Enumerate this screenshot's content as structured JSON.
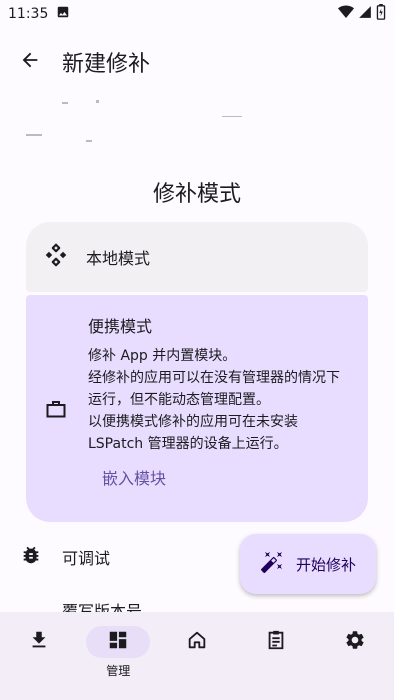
{
  "status_bar": {
    "time": "11:35",
    "icons": [
      "image-icon",
      "wifi-icon",
      "signal-icon",
      "battery-icon"
    ]
  },
  "app_bar": {
    "title": "新建修补",
    "back_icon": "arrow-back-icon"
  },
  "patch_mode": {
    "section_title": "修补模式",
    "options": [
      {
        "label": "本地模式",
        "icon": "apps-diamond-icon",
        "selected": false
      },
      {
        "label": "便携模式",
        "icon": "work-briefcase-icon",
        "selected": true,
        "description": [
          "修补 App 并内置模块。",
          "经修补的应用可以在没有管理器的情况下运行，但不能动态管理配置。",
          "以便携模式修补的应用可在未安装 LSPatch 管理器的设备上运行。"
        ],
        "embed_button": "嵌入模块"
      }
    ]
  },
  "switches": [
    {
      "label": "可调试",
      "icon": "bug-icon"
    },
    {
      "label": "覆写版本号",
      "icon": ""
    }
  ],
  "fab": {
    "label": "开始修补",
    "icon": "auto-fix-wand-icon"
  },
  "bottom_nav": {
    "items": [
      {
        "label": "",
        "icon": "download-icon",
        "active": false
      },
      {
        "label": "管理",
        "icon": "dashboard-icon",
        "active": true
      },
      {
        "label": "",
        "icon": "home-icon",
        "active": false
      },
      {
        "label": "",
        "icon": "assignment-icon",
        "active": false
      },
      {
        "label": "",
        "icon": "settings-icon",
        "active": false
      }
    ]
  },
  "colors": {
    "background": "#fdfbff",
    "surface_variant": "#f3f0f4",
    "selected_container": "#e9ddff",
    "accent": "#6750a4",
    "nav_background": "#f3edf7",
    "nav_indicator": "#e8def8"
  }
}
